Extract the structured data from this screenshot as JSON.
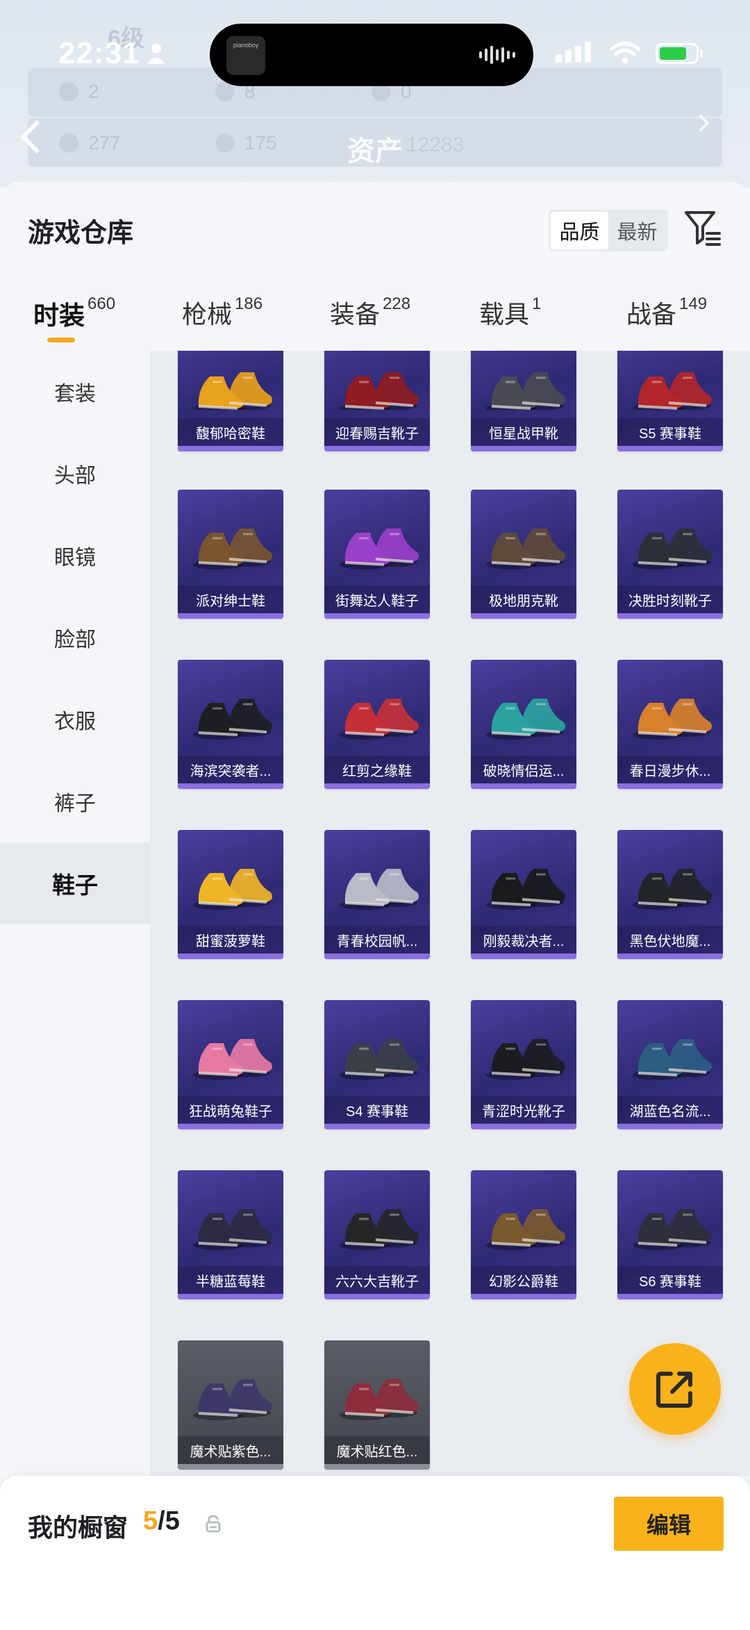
{
  "status_bar": {
    "time": "22:31",
    "island_art_text": "pianoboy"
  },
  "background": {
    "level_label": "6级",
    "stats_row1": [
      "2",
      "8",
      "0"
    ],
    "stats_row2": [
      "277",
      "175"
    ],
    "asset_label": "资产",
    "asset_value": "12283"
  },
  "header": {
    "title": "游戏仓库",
    "sort_options": [
      "品质",
      "最新"
    ],
    "active_sort": "品质"
  },
  "tabs": [
    {
      "label": "时装",
      "count": "660",
      "active": true
    },
    {
      "label": "枪械",
      "count": "186"
    },
    {
      "label": "装备",
      "count": "228"
    },
    {
      "label": "载具",
      "count": "1"
    },
    {
      "label": "战备",
      "count": "149"
    }
  ],
  "side_nav": [
    {
      "label": "套装"
    },
    {
      "label": "头部"
    },
    {
      "label": "眼镜"
    },
    {
      "label": "脸部"
    },
    {
      "label": "衣服"
    },
    {
      "label": "裤子"
    },
    {
      "label": "鞋子",
      "active": true
    }
  ],
  "items": [
    {
      "name": "馥郁哈密鞋",
      "color": "#e8a21c",
      "rarity": "purple"
    },
    {
      "name": "迎春赐吉靴子",
      "color": "#8e1c22",
      "rarity": "purple"
    },
    {
      "name": "恒星战甲靴",
      "color": "#4a4a52",
      "rarity": "purple"
    },
    {
      "name": "S5 赛事鞋",
      "color": "#b3262b",
      "rarity": "purple"
    },
    {
      "name": "派对绅士鞋",
      "color": "#7a5530",
      "rarity": "purple"
    },
    {
      "name": "街舞达人鞋子",
      "color": "#9a3fc9",
      "rarity": "purple"
    },
    {
      "name": "极地朋克靴",
      "color": "#5e4a3a",
      "rarity": "purple"
    },
    {
      "name": "决胜时刻靴子",
      "color": "#2c3036",
      "rarity": "purple"
    },
    {
      "name": "海滨突袭者...",
      "color": "#1e1e22",
      "rarity": "purple"
    },
    {
      "name": "红剪之缘鞋",
      "color": "#c53038",
      "rarity": "purple"
    },
    {
      "name": "破晓情侣运...",
      "color": "#2aa3a0",
      "rarity": "purple"
    },
    {
      "name": "春日漫步休...",
      "color": "#d7812c",
      "rarity": "purple"
    },
    {
      "name": "甜蜜菠萝鞋",
      "color": "#f0b526",
      "rarity": "purple"
    },
    {
      "name": "青春校园帆...",
      "color": "#b9bcc8",
      "rarity": "purple"
    },
    {
      "name": "刚毅裁决者...",
      "color": "#1a1a1c",
      "rarity": "purple"
    },
    {
      "name": "黑色伏地魔...",
      "color": "#232428",
      "rarity": "purple"
    },
    {
      "name": "狂战萌兔鞋子",
      "color": "#e77aa4",
      "rarity": "purple"
    },
    {
      "name": "S4 赛事鞋",
      "color": "#3a3f48",
      "rarity": "purple"
    },
    {
      "name": "青涩时光靴子",
      "color": "#1c1c20",
      "rarity": "purple"
    },
    {
      "name": "湖蓝色名流...",
      "color": "#2c5d82",
      "rarity": "purple"
    },
    {
      "name": "半糖蓝莓鞋",
      "color": "#2d2a44",
      "rarity": "purple"
    },
    {
      "name": "六六大吉靴子",
      "color": "#262629",
      "rarity": "purple"
    },
    {
      "name": "幻影公爵鞋",
      "color": "#7a5a2e",
      "rarity": "purple"
    },
    {
      "name": "S6 赛事鞋",
      "color": "#2f2e3a",
      "rarity": "purple"
    },
    {
      "name": "魔术贴紫色...",
      "color": "#3e3868",
      "rarity": "gray"
    },
    {
      "name": "魔术贴红色...",
      "color": "#8e2e3c",
      "rarity": "gray"
    }
  ],
  "bottom_bar": {
    "title": "我的橱窗",
    "current": "5",
    "separator": "/",
    "total": "5",
    "edit_label": "编辑"
  },
  "colors": {
    "accent": "#f9b21a",
    "card_purple": "#3a3286",
    "card_gray": "#4f5159"
  }
}
